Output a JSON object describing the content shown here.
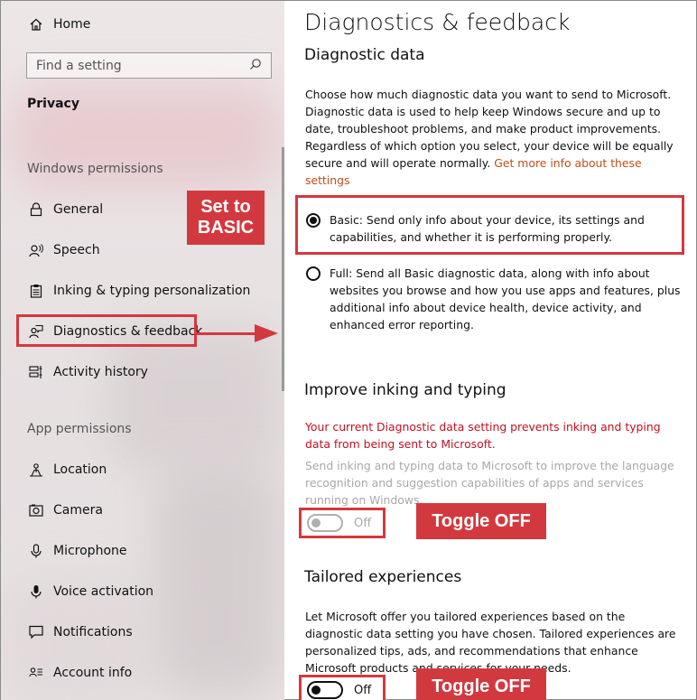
{
  "sidebar": {
    "home_label": "Home",
    "search_placeholder": "Find a setting",
    "category_title": "Privacy",
    "windows_permissions_title": "Windows permissions",
    "app_permissions_title": "App permissions",
    "items": [
      {
        "label": "General",
        "icon": "lock-icon"
      },
      {
        "label": "Speech",
        "icon": "speech-icon"
      },
      {
        "label": "Inking & typing personalization",
        "icon": "clipboard-icon"
      },
      {
        "label": "Diagnostics & feedback",
        "icon": "feedback-icon"
      },
      {
        "label": "Activity history",
        "icon": "timeline-icon"
      }
    ],
    "app_items": [
      {
        "label": "Location",
        "icon": "location-icon"
      },
      {
        "label": "Camera",
        "icon": "camera-icon"
      },
      {
        "label": "Microphone",
        "icon": "microphone-icon"
      },
      {
        "label": "Voice activation",
        "icon": "voice-icon"
      },
      {
        "label": "Notifications",
        "icon": "notification-icon"
      },
      {
        "label": "Account info",
        "icon": "account-icon"
      }
    ]
  },
  "annotations": {
    "set_basic": "Set to BASIC",
    "toggle_off_1": "Toggle OFF",
    "toggle_off_2": "Toggle OFF",
    "accent_color": "#d2393f"
  },
  "main": {
    "page_title": "Diagnostics & feedback",
    "diagnostic": {
      "heading": "Diagnostic data",
      "description": "Choose how much diagnostic data you want to send to Microsoft. Diagnostic data is used to help keep Windows secure and up to date, troubleshoot problems, and make product improvements. Regardless of which option you select, your device will be equally secure and will operate normally.",
      "link": "Get more info about these settings",
      "options": [
        {
          "label": "Basic: Send only info about your device, its settings and capabilities, and whether it is performing properly.",
          "selected": true
        },
        {
          "label": "Full: Send all Basic diagnostic data, along with info about websites you browse and how you use apps and features, plus additional info about device health, device activity, and enhanced error reporting.",
          "selected": false
        }
      ]
    },
    "inking": {
      "heading": "Improve inking and typing",
      "warning": "Your current Diagnostic data setting prevents inking and typing data from being sent to Microsoft.",
      "description": "Send inking and typing data to Microsoft to improve the language recognition and suggestion capabilities of apps and services running on Windows.",
      "toggle_state": "Off"
    },
    "tailored": {
      "heading": "Tailored experiences",
      "description": "Let Microsoft offer you tailored experiences based on the diagnostic data setting you have chosen. Tailored experiences are personalized tips, ads, and recommendations that enhance Microsoft products and services for your needs.",
      "toggle_state": "Off"
    }
  }
}
